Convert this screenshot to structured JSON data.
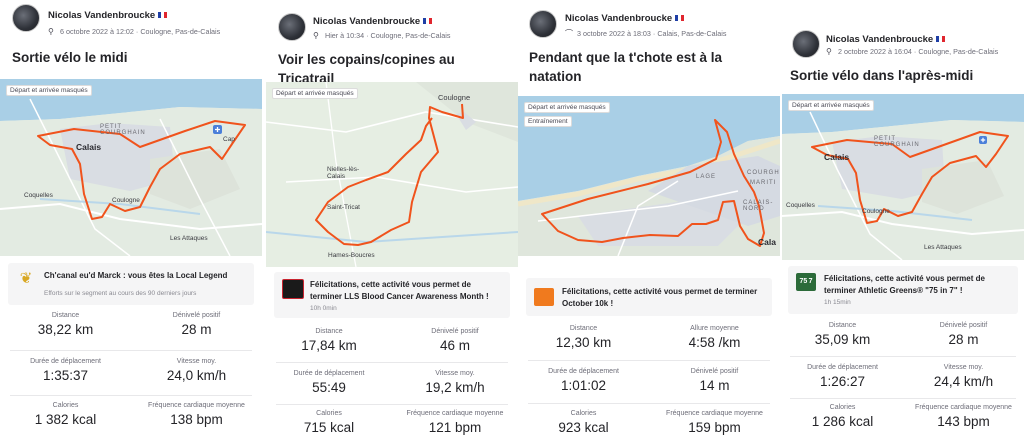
{
  "colors": {
    "route": "#f0531c",
    "accent": "#fc4c02",
    "text": "#242428",
    "muted": "#6d6d78"
  },
  "activities": [
    {
      "athlete": "Nicolas Vandenbroucke",
      "date_location": "6 octobre 2022 à 12:02 · Coulogne, Pas-de-Calais",
      "activity_icon": "bike-icon",
      "title": "Sortie vélo le midi",
      "map_tags": [
        "Départ et arrivée masqués"
      ],
      "map_places": [
        "PETIT COURGHAIN",
        "Calais",
        "Coquelles",
        "Coulogne",
        "Les Attaques",
        "Cap"
      ],
      "banner_title": "Ch'canal eu'd Marck : vous êtes la Local Legend",
      "banner_sub": "Efforts sur le segment au cours des 90 derniers jours",
      "banner_icon": "laurel-icon",
      "stats": [
        {
          "label": "Distance",
          "value": "38,22 km"
        },
        {
          "label": "Dénivelé positif",
          "value": "28 m"
        },
        {
          "label": "Durée de déplacement",
          "value": "1:35:37"
        },
        {
          "label": "Vitesse moy.",
          "value": "24,0 km/h"
        },
        {
          "label": "Calories",
          "value": "1 382 kcal"
        },
        {
          "label": "Fréquence cardiaque moyenne",
          "value": "138 bpm"
        }
      ]
    },
    {
      "athlete": "Nicolas Vandenbroucke",
      "date_location": "Hier à 10:34 · Coulogne, Pas-de-Calais",
      "activity_icon": "bike-icon",
      "title": "Voir les copains/copines au Tricatrail",
      "title_emoji": "😍",
      "map_tags": [
        "Départ et arrivée masqués"
      ],
      "map_places": [
        "Coulogne",
        "Nielles-lès-Calais",
        "Saint-Tricat",
        "Hames-Boucres"
      ],
      "banner_title": "Félicitations, cette activité vous permet de terminer LLS Blood Cancer Awareness Month !",
      "banner_sub": "10h 0min",
      "banner_icon": "lls-badge-icon",
      "stats": [
        {
          "label": "Distance",
          "value": "17,84 km"
        },
        {
          "label": "Dénivelé positif",
          "value": "46 m"
        },
        {
          "label": "Durée de déplacement",
          "value": "55:49"
        },
        {
          "label": "Vitesse moy.",
          "value": "19,2 km/h"
        },
        {
          "label": "Calories",
          "value": "715 kcal"
        },
        {
          "label": "Fréquence cardiaque moyenne",
          "value": "121 bpm"
        }
      ]
    },
    {
      "athlete": "Nicolas Vandenbroucke",
      "date_location": "3 octobre 2022 à 18:03 · Calais, Pas-de-Calais",
      "activity_icon": "shoe-icon",
      "title": "Pendant que la t'chote est à la natation",
      "map_tags": [
        "Départ et arrivée masqués",
        "Entraînement"
      ],
      "map_places": [
        "LAGE",
        "COURGH",
        "MARITI",
        "CALAIS-NORD",
        "Cala"
      ],
      "banner_title": "Félicitations, cette activité vous permet de terminer October 10k !",
      "banner_sub": "",
      "banner_icon": "october-10k-badge-icon",
      "stats": [
        {
          "label": "Distance",
          "value": "12,30 km"
        },
        {
          "label": "Allure moyenne",
          "value": "4:58 /km"
        },
        {
          "label": "Durée de déplacement",
          "value": "1:01:02"
        },
        {
          "label": "Dénivelé positif",
          "value": "14 m"
        },
        {
          "label": "Calories",
          "value": "923 kcal"
        },
        {
          "label": "Fréquence cardiaque moyenne",
          "value": "159 bpm"
        }
      ]
    },
    {
      "athlete": "Nicolas Vandenbroucke",
      "date_location": "2 octobre 2022 à 16:04 · Coulogne, Pas-de-Calais",
      "activity_icon": "bike-icon",
      "title": "Sortie vélo dans l'après-midi",
      "map_tags": [
        "Départ et arrivée masqués"
      ],
      "map_places": [
        "PETIT COURGHAIN",
        "Calais",
        "Coquelles",
        "Coulogne",
        "Les Attaques"
      ],
      "banner_title": "Félicitations, cette activité vous permet de terminer Athletic Greens® \"75 in 7\" !",
      "banner_sub": "1h 15min",
      "banner_icon": "75-in-7-badge-icon",
      "badge_text": "75 7",
      "stats": [
        {
          "label": "Distance",
          "value": "35,09 km"
        },
        {
          "label": "Dénivelé positif",
          "value": "28 m"
        },
        {
          "label": "Durée de déplacement",
          "value": "1:26:27"
        },
        {
          "label": "Vitesse moy.",
          "value": "24,4 km/h"
        },
        {
          "label": "Calories",
          "value": "1 286 kcal"
        },
        {
          "label": "Fréquence cardiaque moyenne",
          "value": "143 bpm"
        }
      ]
    }
  ]
}
